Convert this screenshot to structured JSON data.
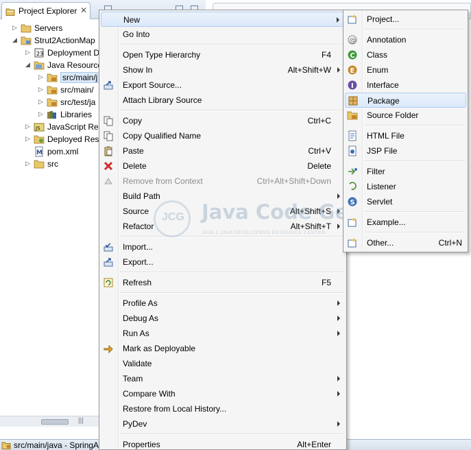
{
  "explorer": {
    "tab_title": "Project Explorer",
    "close_glyph": "✕",
    "tree": [
      {
        "label": "Servers",
        "icon": "folder-icon",
        "indent": 0,
        "twisty": "▷"
      },
      {
        "label": "Strut2ActionMap",
        "icon": "project-icon",
        "indent": 0,
        "twisty": "◢"
      },
      {
        "label": "Deployment D",
        "icon": "deployment-icon",
        "indent": 1,
        "twisty": "▷"
      },
      {
        "label": "Java Resource",
        "icon": "java-resources-icon",
        "indent": 1,
        "twisty": "◢"
      },
      {
        "label": "src/main/j",
        "icon": "source-folder-icon",
        "indent": 2,
        "twisty": "▷",
        "selected": true
      },
      {
        "label": "src/main/",
        "icon": "source-folder-icon",
        "indent": 2,
        "twisty": "▷"
      },
      {
        "label": "src/test/ja",
        "icon": "source-folder-icon",
        "indent": 2,
        "twisty": "▷"
      },
      {
        "label": "Libraries",
        "icon": "library-icon",
        "indent": 2,
        "twisty": "▷"
      },
      {
        "label": "JavaScript Res",
        "icon": "javascript-icon",
        "indent": 1,
        "twisty": "▷"
      },
      {
        "label": "Deployed Reso",
        "icon": "deployed-icon",
        "indent": 1,
        "twisty": "▷"
      },
      {
        "label": "pom.xml",
        "icon": "maven-file-icon",
        "indent": 1,
        "twisty": ""
      },
      {
        "label": "src",
        "icon": "folder-icon",
        "indent": 1,
        "twisty": "▷"
      }
    ],
    "scroll_grip": "|||"
  },
  "status_bar": {
    "text": "src/main/java - SpringA"
  },
  "context_menu": {
    "items": [
      {
        "label": "New",
        "key": "",
        "submenu": true,
        "highlighted": true,
        "icon": ""
      },
      {
        "label": "Go Into",
        "key": "",
        "icon": ""
      },
      {
        "sep": true
      },
      {
        "label": "Open Type Hierarchy",
        "key": "F4",
        "icon": ""
      },
      {
        "label": "Show In",
        "key": "Alt+Shift+W",
        "submenu": true,
        "icon": ""
      },
      {
        "label": "Export Source...",
        "key": "",
        "icon": "export-source-icon"
      },
      {
        "label": "Attach Library Source",
        "key": "",
        "icon": ""
      },
      {
        "sep": true
      },
      {
        "label": "Copy",
        "key": "Ctrl+C",
        "icon": "copy-icon"
      },
      {
        "label": "Copy Qualified Name",
        "key": "",
        "icon": "copy-qualified-icon"
      },
      {
        "label": "Paste",
        "key": "Ctrl+V",
        "icon": "paste-icon"
      },
      {
        "label": "Delete",
        "key": "Delete",
        "icon": "delete-icon"
      },
      {
        "label": "Remove from Context",
        "key": "Ctrl+Alt+Shift+Down",
        "disabled": true,
        "icon": "remove-context-icon"
      },
      {
        "label": "Build Path",
        "key": "",
        "submenu": true,
        "icon": ""
      },
      {
        "label": "Source",
        "key": "Alt+Shift+S",
        "submenu": true,
        "icon": ""
      },
      {
        "label": "Refactor",
        "key": "Alt+Shift+T",
        "submenu": true,
        "icon": ""
      },
      {
        "sep": true
      },
      {
        "label": "Import...",
        "key": "",
        "icon": "import-icon"
      },
      {
        "label": "Export...",
        "key": "",
        "icon": "export-icon"
      },
      {
        "sep": true
      },
      {
        "label": "Refresh",
        "key": "F5",
        "icon": "refresh-icon"
      },
      {
        "sep": true
      },
      {
        "label": "Profile As",
        "key": "",
        "submenu": true,
        "icon": ""
      },
      {
        "label": "Debug As",
        "key": "",
        "submenu": true,
        "icon": ""
      },
      {
        "label": "Run As",
        "key": "",
        "submenu": true,
        "icon": ""
      },
      {
        "label": "Mark as Deployable",
        "key": "",
        "icon": "deployable-icon"
      },
      {
        "label": "Validate",
        "key": "",
        "icon": ""
      },
      {
        "label": "Team",
        "key": "",
        "submenu": true,
        "icon": ""
      },
      {
        "label": "Compare With",
        "key": "",
        "submenu": true,
        "icon": ""
      },
      {
        "label": "Restore from Local History...",
        "key": "",
        "icon": ""
      },
      {
        "label": "PyDev",
        "key": "",
        "submenu": true,
        "icon": ""
      },
      {
        "sep": true
      },
      {
        "label": "Properties",
        "key": "Alt+Enter",
        "icon": ""
      }
    ]
  },
  "new_submenu": {
    "items": [
      {
        "label": "Project...",
        "key": "",
        "icon": "new-project-icon"
      },
      {
        "sep": true
      },
      {
        "label": "Annotation",
        "key": "",
        "icon": "annotation-icon"
      },
      {
        "label": "Class",
        "key": "",
        "icon": "class-icon"
      },
      {
        "label": "Enum",
        "key": "",
        "icon": "enum-icon"
      },
      {
        "label": "Interface",
        "key": "",
        "icon": "interface-icon"
      },
      {
        "label": "Package",
        "key": "",
        "icon": "package-icon",
        "highlighted": true
      },
      {
        "label": "Source Folder",
        "key": "",
        "icon": "source-folder-icon"
      },
      {
        "sep": true
      },
      {
        "label": "HTML File",
        "key": "",
        "icon": "html-file-icon"
      },
      {
        "label": "JSP File",
        "key": "",
        "icon": "jsp-file-icon"
      },
      {
        "sep": true
      },
      {
        "label": "Filter",
        "key": "",
        "icon": "filter-icon"
      },
      {
        "label": "Listener",
        "key": "",
        "icon": "listener-icon"
      },
      {
        "label": "Servlet",
        "key": "",
        "icon": "servlet-icon"
      },
      {
        "sep": true
      },
      {
        "label": "Example...",
        "key": "",
        "icon": "example-icon"
      },
      {
        "sep": true
      },
      {
        "label": "Other...",
        "key": "Ctrl+N",
        "icon": "other-wizard-icon"
      }
    ]
  },
  "watermark": {
    "logo": "JCG",
    "name": "Java Code Geeks",
    "tagline": "JAVA 2 JAVA DEVELOPERS RESOURCE CENTER"
  },
  "colors": {
    "highlight": "#dbe9f9",
    "highlight_border": "#aeccf0",
    "menu_bg": "#f5f5f5",
    "disabled_text": "#8d8d8d"
  }
}
